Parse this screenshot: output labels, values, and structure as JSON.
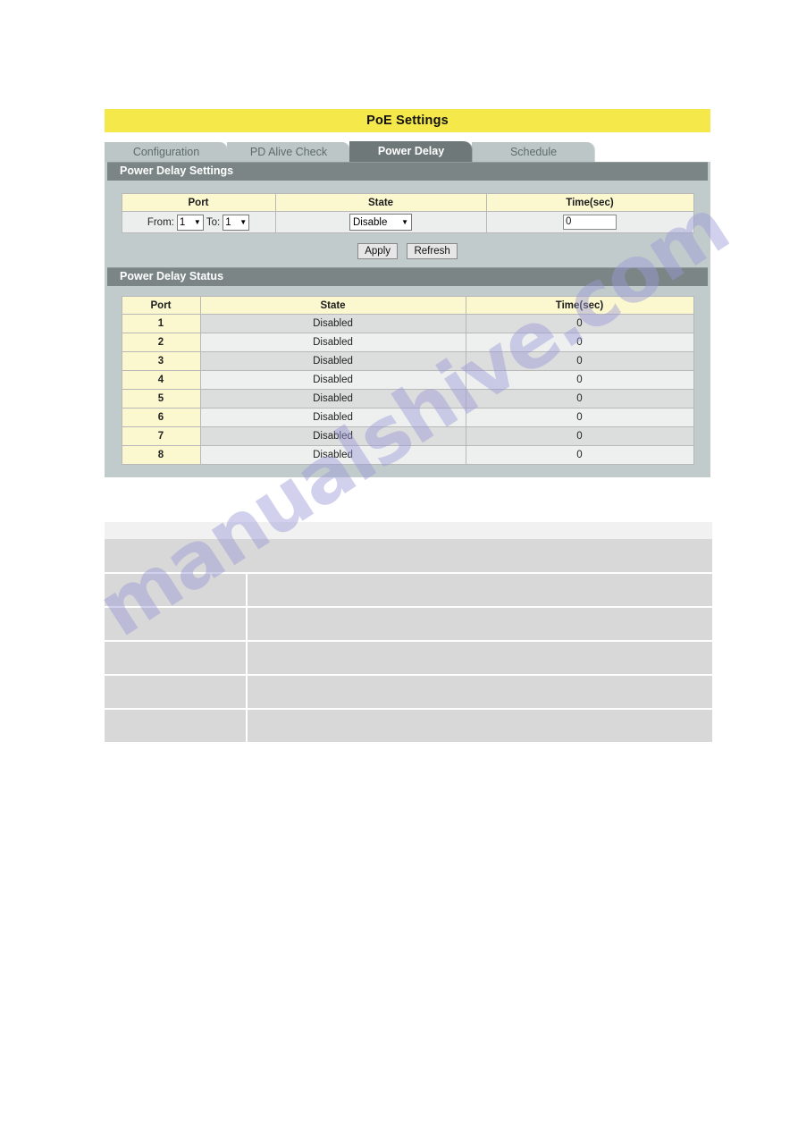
{
  "page": {
    "title": "PoE Settings"
  },
  "tabs": [
    {
      "label": "Configuration",
      "active": false
    },
    {
      "label": "PD Alive Check",
      "active": false
    },
    {
      "label": "Power Delay",
      "active": true
    },
    {
      "label": "Schedule",
      "active": false
    }
  ],
  "settings_section": {
    "heading": "Power Delay Settings",
    "headers": [
      "Port",
      "State",
      "Time(sec)"
    ],
    "port_from_label": "From:",
    "port_to_label": "To:",
    "port_from_value": "1",
    "port_to_value": "1",
    "state_value": "Disable",
    "time_value": "0",
    "buttons": {
      "apply": "Apply",
      "refresh": "Refresh"
    }
  },
  "status_section": {
    "heading": "Power Delay Status",
    "headers": [
      "Port",
      "State",
      "Time(sec)"
    ],
    "rows": [
      {
        "port": "1",
        "state": "Disabled",
        "time": "0"
      },
      {
        "port": "2",
        "state": "Disabled",
        "time": "0"
      },
      {
        "port": "3",
        "state": "Disabled",
        "time": "0"
      },
      {
        "port": "4",
        "state": "Disabled",
        "time": "0"
      },
      {
        "port": "5",
        "state": "Disabled",
        "time": "0"
      },
      {
        "port": "6",
        "state": "Disabled",
        "time": "0"
      },
      {
        "port": "7",
        "state": "Disabled",
        "time": "0"
      },
      {
        "port": "8",
        "state": "Disabled",
        "time": "0"
      }
    ]
  },
  "watermark": {
    "text": "manualshive.com"
  },
  "colors": {
    "title_bar": "#f5e84b",
    "panel": "#c2cbcb",
    "section_head": "#7b8585",
    "tab_inactive": "#bcc6c6",
    "tab_active": "#6e7878",
    "table_header": "#fbf8cf",
    "row_odd": "#dcdddd",
    "row_even": "#eef0f0"
  }
}
